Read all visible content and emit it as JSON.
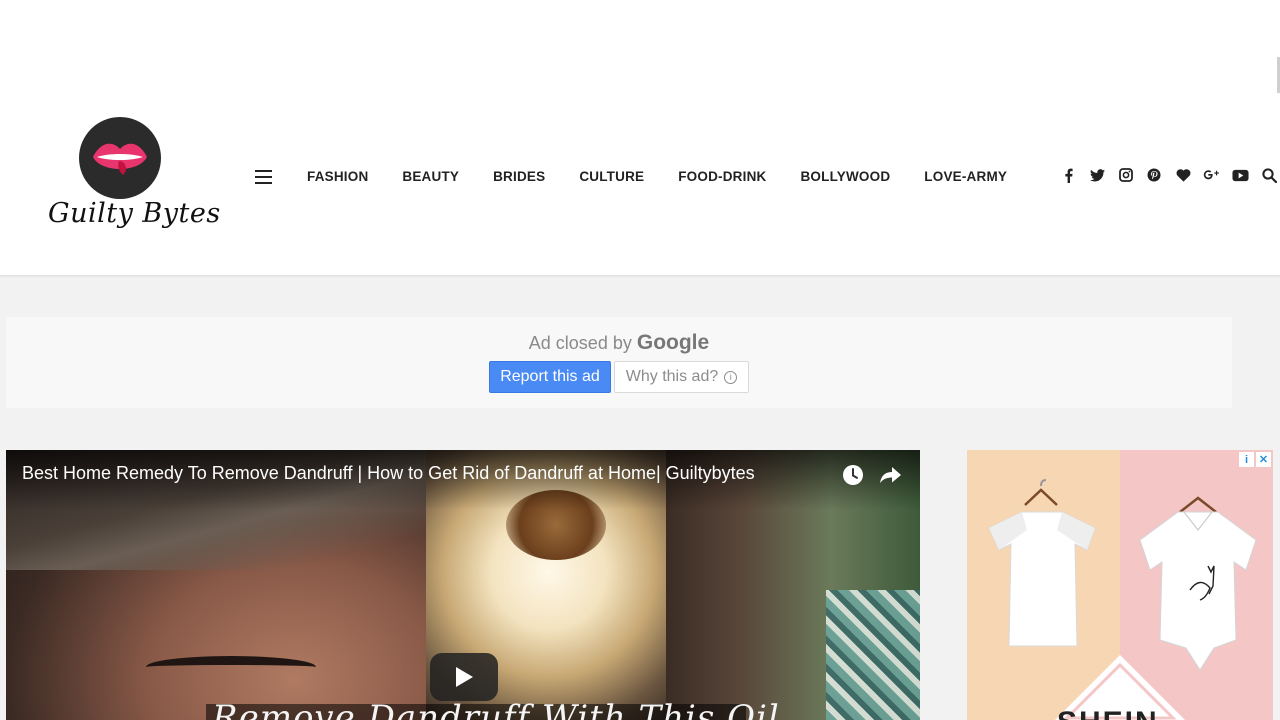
{
  "site": {
    "logo_text": "Guilty Bytes"
  },
  "nav": {
    "items": [
      "FASHION",
      "BEAUTY",
      "BRIDES",
      "CULTURE",
      "FOOD-DRINK",
      "BOLLYWOOD",
      "LOVE-ARMY"
    ]
  },
  "social": {
    "icons": [
      "facebook-icon",
      "twitter-icon",
      "instagram-icon",
      "pinterest-icon",
      "heart-icon",
      "google-plus-icon",
      "youtube-icon",
      "search-icon"
    ]
  },
  "ad_notice": {
    "closed_by": "Ad closed by",
    "brand": "Google",
    "report_label": "Report this ad",
    "why_label": "Why this ad?",
    "info_glyph": "i"
  },
  "video": {
    "title": "Best Home Remedy To Remove Dandruff | How to Get Rid of Dandruff at Home| Guiltybytes",
    "caption_partial": "Remove Dandruff With This Oil"
  },
  "side_ad": {
    "badge_info": "i",
    "badge_close": "✕",
    "partial_word": "SHEIN"
  },
  "colors": {
    "report_button": "#4a8af4",
    "logo_lips": "#e8356e",
    "logo_circle": "#2b2b2b"
  }
}
